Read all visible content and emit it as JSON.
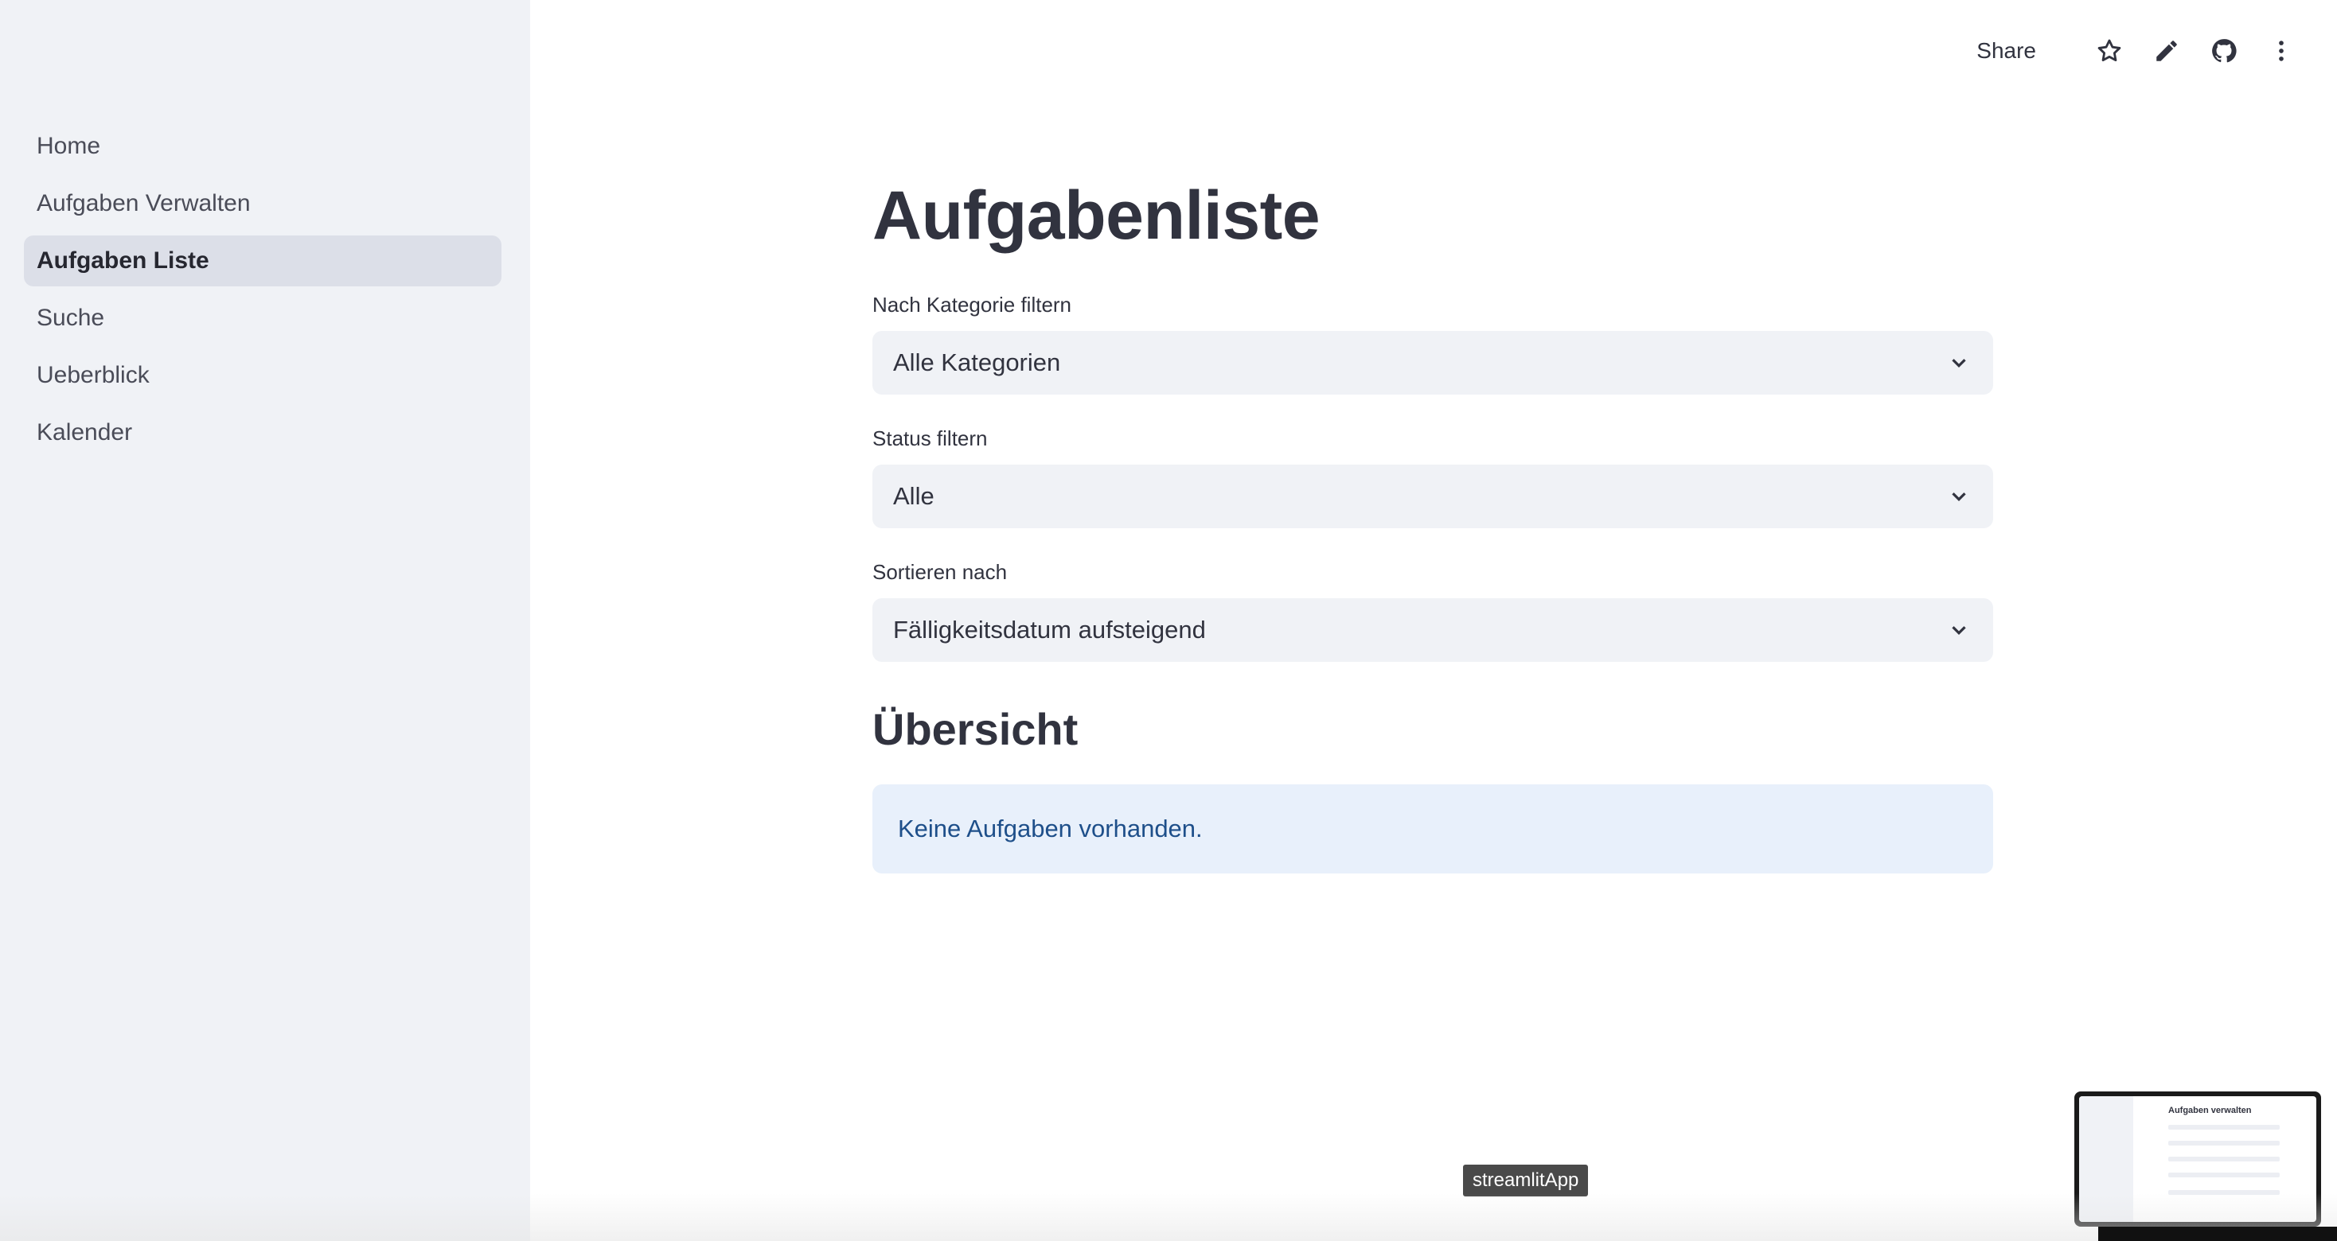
{
  "toolbar": {
    "share_label": "Share",
    "icons": [
      "star-icon",
      "pencil-icon",
      "github-icon",
      "more-vertical-icon"
    ]
  },
  "sidebar": {
    "items": [
      {
        "label": "Home",
        "active": false
      },
      {
        "label": "Aufgaben Verwalten",
        "active": false
      },
      {
        "label": "Aufgaben Liste",
        "active": true
      },
      {
        "label": "Suche",
        "active": false
      },
      {
        "label": "Ueberblick",
        "active": false
      },
      {
        "label": "Kalender",
        "active": false
      }
    ]
  },
  "main": {
    "title": "Aufgabenliste",
    "filters": {
      "category": {
        "label": "Nach Kategorie filtern",
        "value": "Alle Kategorien"
      },
      "status": {
        "label": "Status filtern",
        "value": "Alle"
      },
      "sort": {
        "label": "Sortieren nach",
        "value": "Fälligkeitsdatum aufsteigend"
      }
    },
    "section_title": "Übersicht",
    "info_message": "Keine Aufgaben vorhanden."
  },
  "tooltip": "streamlitApp",
  "thumbnail": {
    "title": "Aufgaben verwalten"
  },
  "colors": {
    "sidebar_bg": "#f0f2f6",
    "active_item_bg": "#dcdfe8",
    "select_bg": "#f0f2f6",
    "info_bg": "#e8f0fb",
    "info_text": "#1e4f8a",
    "text": "#31333f"
  }
}
